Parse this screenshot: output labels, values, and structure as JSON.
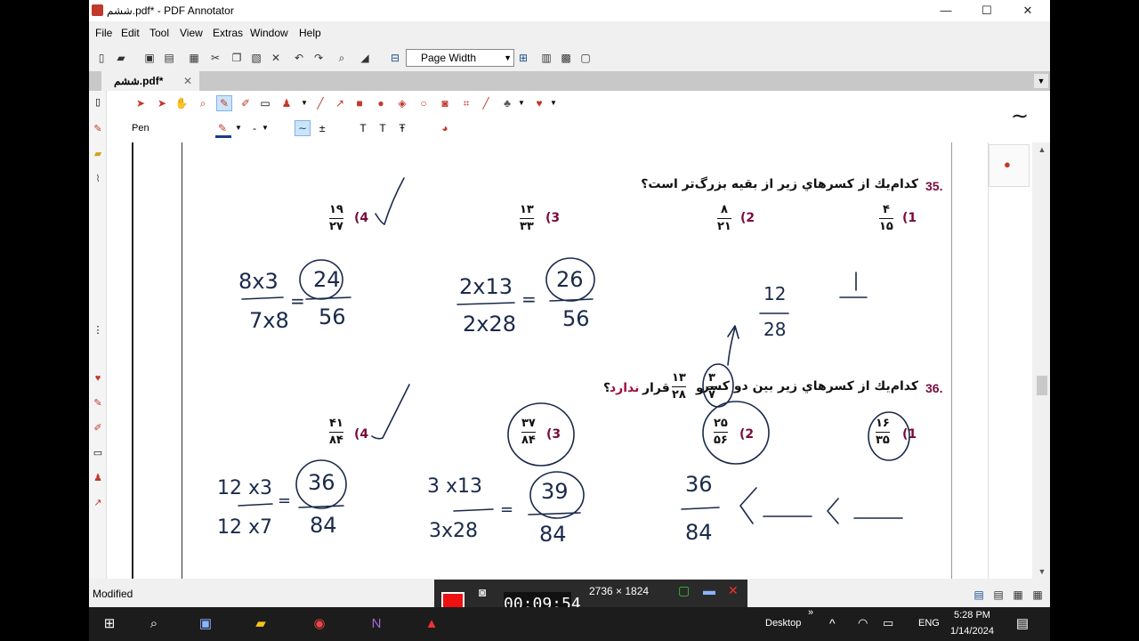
{
  "window": {
    "title": "ششم.pdf* - PDF Annotator",
    "minimize": "—",
    "maximize": "☐",
    "close": "✕"
  },
  "menu": [
    "File",
    "Edit",
    "Tool",
    "View",
    "Extras",
    "Window",
    "Help"
  ],
  "toolbar": {
    "zoom_value": "Page Width"
  },
  "tab": {
    "label": "ششم.pdf*",
    "close": "✕"
  },
  "annot": {
    "tool_label": "Pen",
    "accent_color": "#1a3a8a",
    "pen_color": "#c0392b"
  },
  "doc": {
    "q35": {
      "number": "35.",
      "text": "كدام‌يك از كسرهاي زير از بقيه بزرگ‌تر است؟",
      "options": [
        {
          "num": "(1",
          "top": "۴",
          "bottom": "۱۵"
        },
        {
          "num": "(2",
          "top": "۸",
          "bottom": "۲۱"
        },
        {
          "num": "(3",
          "top": "۱۳",
          "bottom": "۳۳"
        },
        {
          "num": "(4",
          "top": "۱۹",
          "bottom": "۲۷"
        }
      ]
    },
    "q36": {
      "number": "36.",
      "text_a": "كدام‌يك از كسرهاي زير بين دو كسر",
      "frac_a_top": "۳",
      "frac_a_bottom": "۷",
      "and": "و",
      "frac_b_top": "۱۳",
      "frac_b_bottom": "۲۸",
      "text_b": "قرار",
      "text_neg": "ندارد",
      "text_end": "؟",
      "options": [
        {
          "num": "(1",
          "top": "۱۶",
          "bottom": "۳۵"
        },
        {
          "num": "(2",
          "top": "۲۵",
          "bottom": "۵۶"
        },
        {
          "num": "(3",
          "top": "۳۷",
          "bottom": "۸۴"
        },
        {
          "num": "(4",
          "top": "۴۱",
          "bottom": "۸۴"
        }
      ]
    },
    "handwriting": {
      "r1a_top": "8x3",
      "r1a_bot": "7x8",
      "r1a_res_top": "24",
      "r1a_res_bot": "56",
      "r1b_top": "2x13",
      "r1b_bot": "2x28",
      "r1b_res_top": "26",
      "r1b_res_bot": "56",
      "r1c_top": "12",
      "r1c_bot": "28",
      "r2a_top": "12 x3",
      "r2a_bot": "12 x7",
      "r2a_res_top": "36",
      "r2a_res_bot": "84",
      "r2b_top": "3 x13",
      "r2b_bot": "3x28",
      "r2b_res_top": "39",
      "r2b_res_bot": "84",
      "r2c_top": "36",
      "r2c_bot": "84",
      "eq": "="
    }
  },
  "status": {
    "text": "Modified"
  },
  "recorder": {
    "timer": "00:09:54",
    "resolution": "2736 × 1824"
  },
  "taskbar": {
    "desktop": "Desktop",
    "lang": "ENG",
    "time": "5:28 PM",
    "date": "1/14/2024"
  }
}
